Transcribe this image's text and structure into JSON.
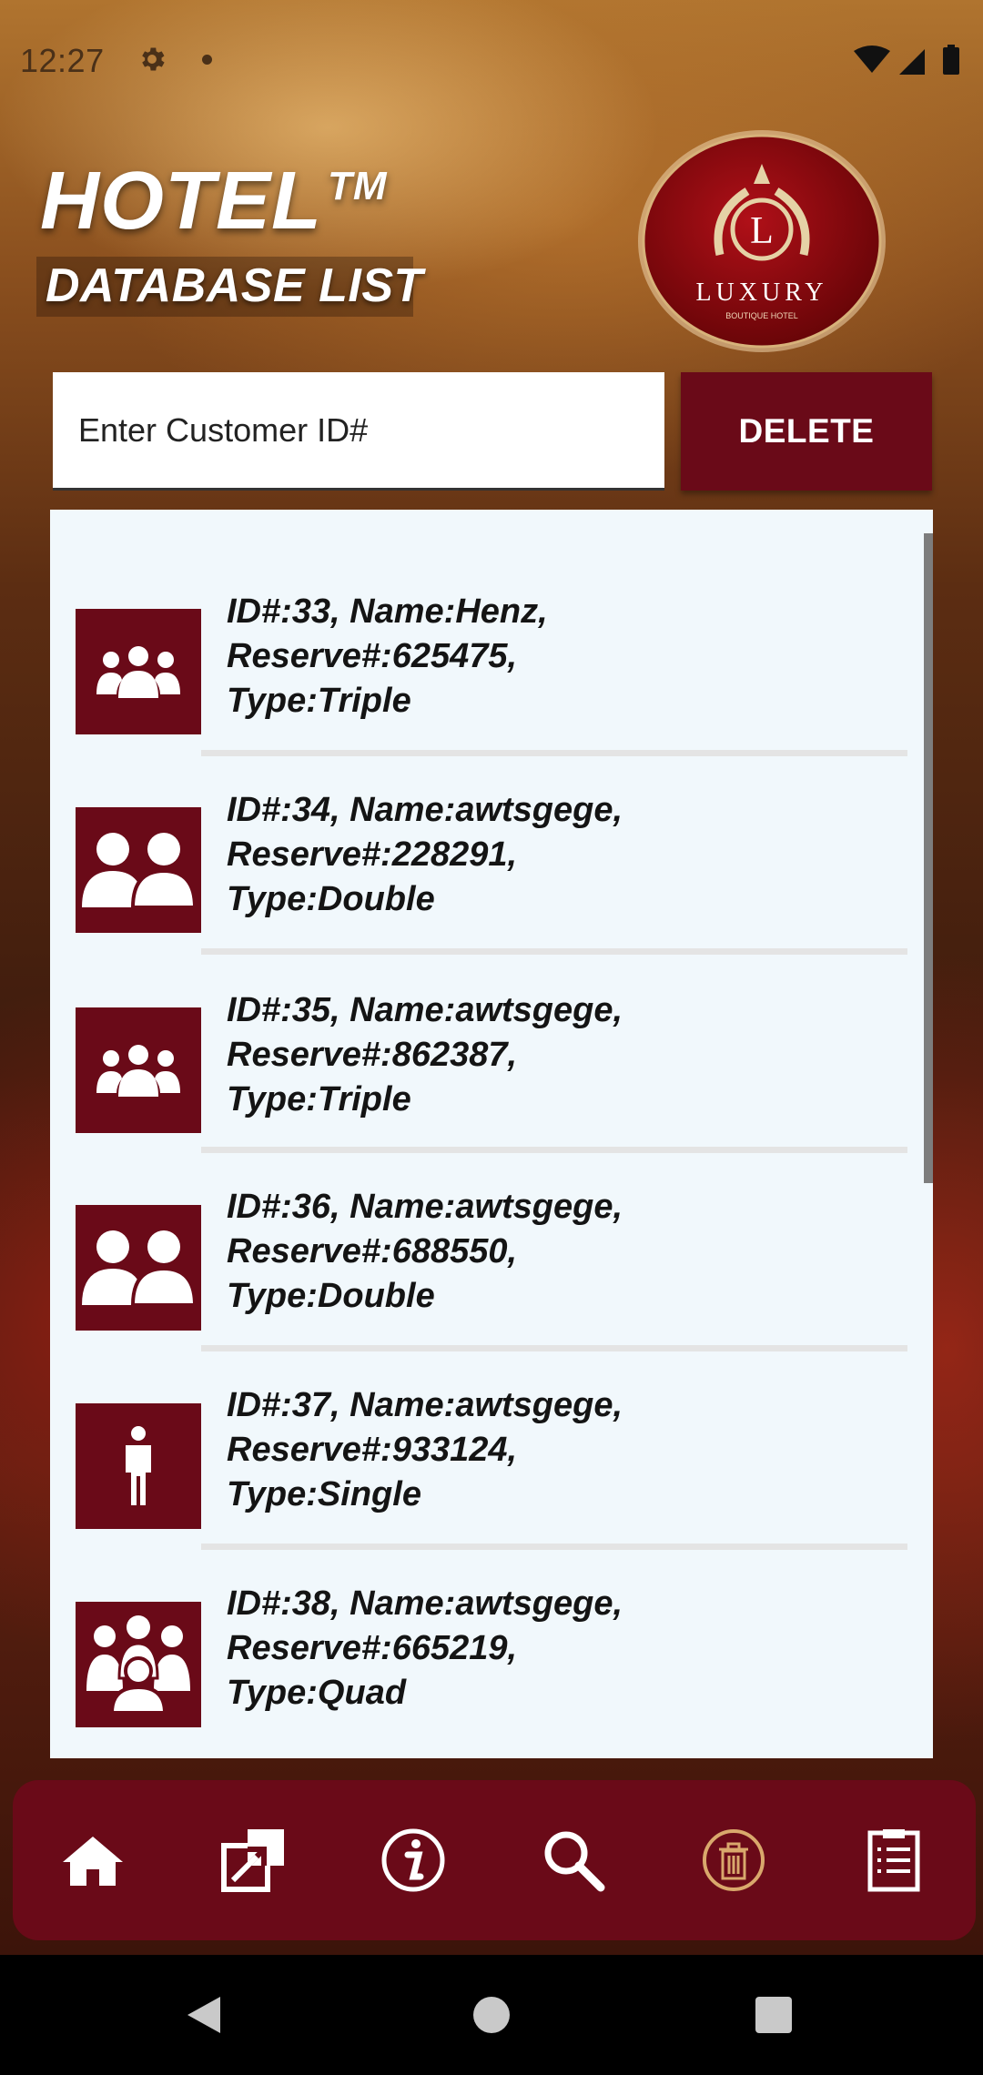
{
  "status_bar": {
    "time": "12:27"
  },
  "header": {
    "title": "HOTEL",
    "trademark": "TM",
    "subtitle": "DATABASE LIST"
  },
  "logo": {
    "letter": "L",
    "name": "LUXURY",
    "tagline": "BOUTIQUE HOTEL"
  },
  "search": {
    "placeholder": "Enter Customer ID#",
    "value": ""
  },
  "delete_button": {
    "label": "DELETE"
  },
  "customers": [
    {
      "line1": "ID#:33, Name:Henz,",
      "line2": "Reserve#:625475,",
      "line3": "Type:Triple",
      "icon": "group-of-three-icon"
    },
    {
      "line1": "ID#:34, Name:awtsgege,",
      "line2": "Reserve#:228291,",
      "line3": "Type:Double",
      "icon": "two-people-icon"
    },
    {
      "line1": "ID#:35, Name:awtsgege,",
      "line2": "Reserve#:862387,",
      "line3": "Type:Triple",
      "icon": "group-of-three-icon"
    },
    {
      "line1": "ID#:36, Name:awtsgege,",
      "line2": "Reserve#:688550,",
      "line3": "Type:Double",
      "icon": "two-people-icon"
    },
    {
      "line1": "ID#:37, Name:awtsgege,",
      "line2": "Reserve#:933124,",
      "line3": "Type:Single",
      "icon": "single-person-icon"
    },
    {
      "line1": "ID#:38, Name:awtsgege,",
      "line2": "Reserve#:665219,",
      "line3": "Type:Quad",
      "icon": "group-of-four-icon"
    }
  ],
  "bottom_nav": [
    "home-icon",
    "external-link-icon",
    "info-icon",
    "search-icon",
    "trash-icon",
    "checklist-icon"
  ],
  "colors": {
    "brand": "#6a0a18",
    "list_bg": "#f1f8fc",
    "trash_accent": "#d9a86c"
  }
}
